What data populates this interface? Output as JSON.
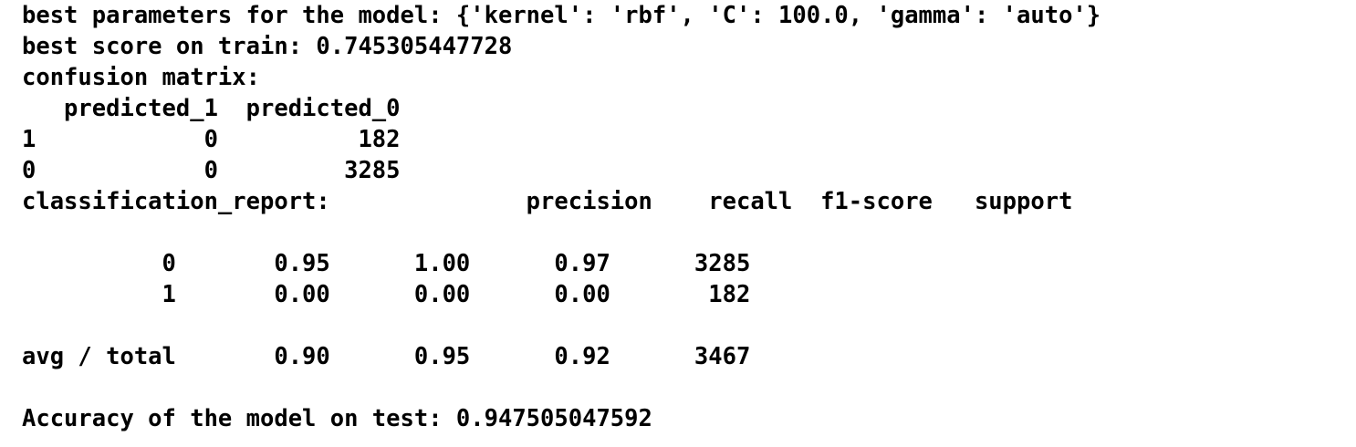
{
  "output": {
    "lines": [
      "best parameters for the model: {'kernel': 'rbf', 'C': 100.0, 'gamma': 'auto'}",
      "best score on train: 0.745305447728",
      "confusion matrix:",
      "   predicted_1  predicted_0",
      "1            0          182",
      "0            0         3285",
      "classification_report:              precision    recall  f1-score   support",
      "",
      "          0       0.95      1.00      0.97      3285",
      "          1       0.00      0.00      0.00       182",
      "",
      "avg / total       0.90      0.95      0.92      3467",
      "",
      "Accuracy of the model on test: 0.947505047592"
    ]
  }
}
